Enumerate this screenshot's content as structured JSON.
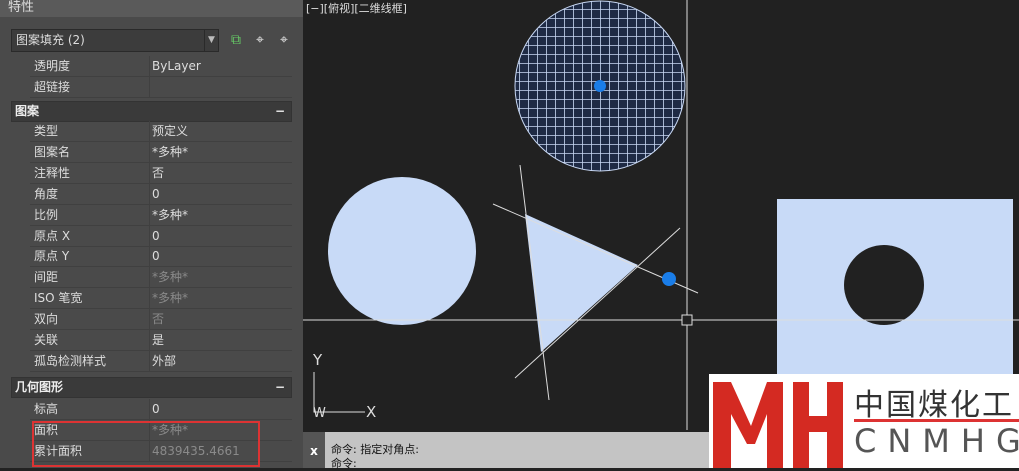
{
  "panel": {
    "title": "特性",
    "selector": "图案填充 (2)",
    "top_rows": [
      {
        "k": "透明度",
        "v": "ByLayer"
      },
      {
        "k": "超链接",
        "v": ""
      }
    ],
    "pattern_header": "图案",
    "pattern_rows": [
      {
        "k": "类型",
        "v": "预定义"
      },
      {
        "k": "图案名",
        "v": "*多种*"
      },
      {
        "k": "注释性",
        "v": "否"
      },
      {
        "k": "角度",
        "v": "0"
      },
      {
        "k": "比例",
        "v": "*多种*"
      },
      {
        "k": "原点 X",
        "v": "0"
      },
      {
        "k": "原点 Y",
        "v": "0"
      },
      {
        "k": "间距",
        "v": "*多种*"
      },
      {
        "k": "ISO 笔宽",
        "v": "*多种*"
      },
      {
        "k": "双向",
        "v": "否"
      },
      {
        "k": "关联",
        "v": "是"
      },
      {
        "k": "孤岛检测样式",
        "v": "外部"
      }
    ],
    "geom_header": "几何图形",
    "geom_rows": [
      {
        "k": "标高",
        "v": "0"
      },
      {
        "k": "面积",
        "v": "*多种*"
      },
      {
        "k": "累计面积",
        "v": "4839435.4661"
      }
    ],
    "collapse": "−"
  },
  "viewport": {
    "label": "[−][俯视][二维线框]",
    "ucs_y": "Y",
    "ucs_x": "X",
    "ucs_w": "W"
  },
  "command": {
    "line1": "命令: 指定对角点:",
    "line2": "命令:",
    "close": "x"
  },
  "logo": {
    "mark": "MH",
    "cn": "中国煤化工",
    "en": "CNMHG"
  }
}
